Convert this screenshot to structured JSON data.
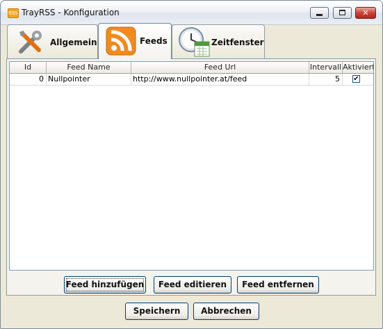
{
  "window": {
    "title": "TrayRSS - Konfiguration",
    "icon_text": "RSS",
    "close_glyph": "✕"
  },
  "tabs": [
    {
      "label": "Allgemein",
      "icon": "tools-icon"
    },
    {
      "label": "Feeds",
      "icon": "rss-icon"
    },
    {
      "label": "Zeitfenster",
      "icon": "clock-calendar-icon"
    }
  ],
  "table": {
    "columns": [
      "Id",
      "Feed Name",
      "Feed Url",
      "Intervall",
      "Aktiviert"
    ],
    "rows": [
      {
        "id": "0",
        "name": "Nullpointer",
        "url": "http://www.nullpointer.at/feed",
        "interval": "5",
        "active": "✔"
      }
    ]
  },
  "feed_buttons": {
    "add": "Feed hinzufügen",
    "edit": "Feed editieren",
    "remove": "Feed entfernen"
  },
  "dialog_buttons": {
    "save": "Speichern",
    "cancel": "Abbrechen"
  },
  "colors": {
    "rss_orange": "#f28a1e",
    "tab_active_border": "#6a85aa",
    "close_red": "#c9453a"
  }
}
